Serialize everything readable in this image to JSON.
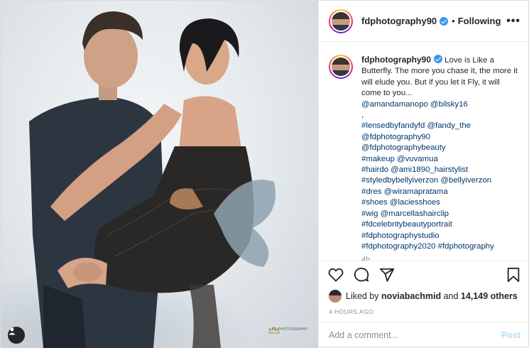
{
  "header": {
    "username": "fdphotography90",
    "separator": "•",
    "follow_status": "Following",
    "more": "•••"
  },
  "photo": {
    "watermark_text": "FD PHOTOGRAPHY"
  },
  "caption": {
    "username": "fdphotography90",
    "text": "Love is Like a Butterfly. The more you chase it, the more it will elude you. But if you let it Fly, it will come to you...",
    "mentions_line": "@amandamanopo @bilsky16",
    "comma": ",",
    "tag_lines": [
      "#lensedbyfandyfd @fandy_the",
      "@fdphotography90",
      "@fdphotographybeauty",
      "#makeup @vuvamua",
      "#hairdo @ami1890_hairstylist",
      "#styledbybellyiverzon @bellyiverzon",
      "#dres @wiramapratama",
      "#shoes @laciesshoes",
      "#wig @marcellashairclip",
      "#fdcelebritybeautyportrait",
      "#fdphotographystudio",
      "#fdphotography2020 #fdphotography"
    ],
    "time_ago": "4h"
  },
  "actions": {
    "liked_by_prefix": "Liked by",
    "liked_by_user": "noviabachmid",
    "and_text": "and",
    "others_count": "14,149 others",
    "timestamp": "4 HOURS AGO"
  },
  "comment": {
    "placeholder": "Add a comment...",
    "post_label": "Post"
  },
  "icons": {
    "like": "heart-icon",
    "comment": "comment-icon",
    "share": "paper-plane-icon",
    "save": "bookmark-icon",
    "tag": "user-tag-icon"
  },
  "colors": {
    "link": "#00376b",
    "verified": "#3897f0",
    "post_disabled": "#b2dffc",
    "muted": "#8e8e8e"
  }
}
